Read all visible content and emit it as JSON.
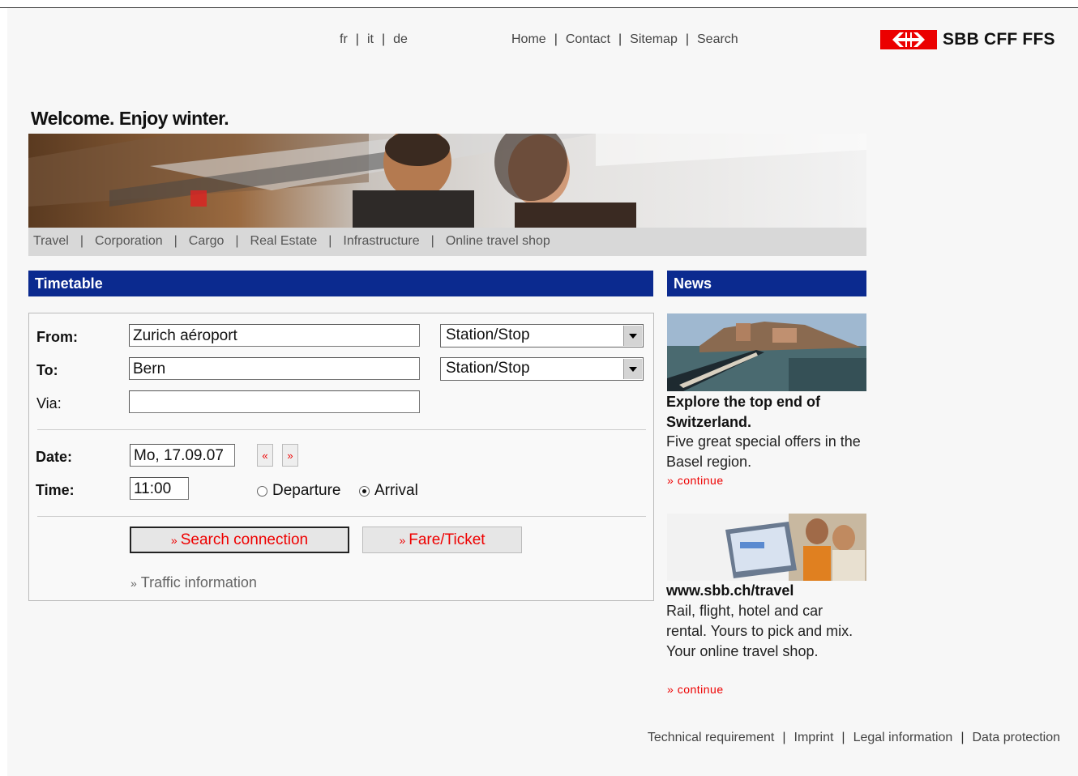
{
  "languages": [
    "fr",
    "it",
    "de"
  ],
  "topnav": [
    "Home",
    "Contact",
    "Sitemap",
    "Search"
  ],
  "logo": {
    "text": "SBB CFF FFS",
    "color": "#eb0000"
  },
  "welcome": "Welcome. Enjoy winter.",
  "subnav": [
    "Travel",
    "Corporation",
    "Cargo",
    "Real Estate",
    "Infrastructure",
    "Online travel shop"
  ],
  "timetable": {
    "header": "Timetable",
    "from_label": "From:",
    "from_value": "Zurich aéroport",
    "from_type": "Station/Stop",
    "to_label": "To:",
    "to_value": "Bern",
    "to_type": "Station/Stop",
    "via_label": "Via:",
    "via_value": "",
    "date_label": "Date:",
    "date_value": "Mo, 17.09.07",
    "prev_day": "«",
    "next_day": "»",
    "time_label": "Time:",
    "time_value": "11:00",
    "departure_label": "Departure",
    "arrival_label": "Arrival",
    "selected_mode": "Arrival",
    "search_button": "Search connection",
    "fare_button": "Fare/Ticket",
    "traffic_link": "Traffic information",
    "accent_color": "#0b2a8f"
  },
  "news": {
    "header": "News",
    "items": [
      {
        "title": "Explore the top end of Switzerland.",
        "text": "Five great special offers in the Basel region.",
        "link": "continue"
      },
      {
        "title": "www.sbb.ch/travel",
        "text": "Rail, flight, hotel and car rental. Yours to pick and mix. Your online travel shop.",
        "link": "continue"
      }
    ]
  },
  "footer": [
    "Technical requirement",
    "Imprint",
    "Legal information",
    "Data protection"
  ]
}
